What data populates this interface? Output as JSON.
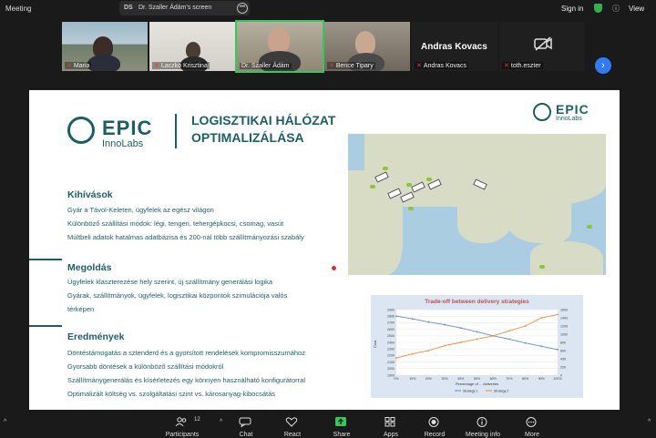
{
  "topbar": {
    "app_title": "Meeting",
    "share": {
      "initials": "DS",
      "label": "Dr. Szaller Ádám's screen",
      "more": "•••"
    },
    "sign_in": "Sign in",
    "view": "View"
  },
  "participants": [
    {
      "name": "Maria"
    },
    {
      "name": "Laczko Krisztina"
    },
    {
      "name": "Dr. Szaller Ádám"
    },
    {
      "name": "Bence Tipary"
    },
    {
      "name": "Andras Kovacs",
      "display": "Andras Kovacs"
    },
    {
      "name": "toth.eszter"
    }
  ],
  "slide": {
    "logo_main": "EPIC",
    "logo_sub": "InnoLabs",
    "title_line1": "LOGISZTIKAI HÁLÓZAT",
    "title_line2": "OPTIMALIZÁLÁSA",
    "sections": [
      {
        "heading": "Kihívások",
        "lines": [
          "Gyár a Távol-Keleten, ügyfelek az egész világon",
          "Különböző szállítási módok: légi, tengeri, tehergépkocsi, csomag, vasút",
          "Múltbeli adatok hatalmas adatbázisa és 200-nál több szállítmányozási szabály"
        ]
      },
      {
        "heading": "Megoldás",
        "lines": [
          "Ügyfelek klaszterezése hely szerint, új szállítmány generálási logika",
          "Gyárak, szállítmányok, ügyfelek, logisztikai központok szimulációja valós",
          "térképen"
        ]
      },
      {
        "heading": "Eredmények",
        "lines": [
          "Döntéstámogatás a sztenderd és a gyorsított rendelések kompromisszumához",
          "Gyorsabb döntések a különböző szállítási módokról",
          "Szállítmánygenerálás és kísérletezés egy könnyen használható konfigurátorral",
          "Optimalizált költség vs. szolgáltatási szint vs. károsanyag-kibocsátás"
        ]
      }
    ]
  },
  "chart_data": {
    "type": "line",
    "title": "Trade-off between delivery strategies",
    "x": [
      "0%",
      "10%",
      "20%",
      "30%",
      "40%",
      "50%",
      "60%",
      "70%",
      "80%",
      "90%",
      "100%"
    ],
    "xlabel": "Percentage of ... deliveries",
    "ylabel": "Cost",
    "y_left_ticks": [
      1900,
      2000,
      2100,
      2200,
      2300,
      2400,
      2500,
      2600,
      2700,
      2800,
      2900
    ],
    "y_right_ticks": [
      0,
      200,
      400,
      600,
      800,
      1000,
      1200,
      1400,
      1600
    ],
    "ylim_left": [
      1900,
      2900
    ],
    "ylim_right": [
      0,
      1600
    ],
    "series": [
      {
        "name": "Strategy 1",
        "axis": "left",
        "color": "#5b8fc7",
        "values": [
          2800,
          2760,
          2710,
          2670,
          2620,
          2560,
          2500,
          2450,
          2390,
          2340,
          2290
        ]
      },
      {
        "name": "Strategy 2",
        "axis": "right",
        "color": "#f08c3a",
        "values": [
          420,
          520,
          600,
          720,
          800,
          880,
          960,
          1080,
          1200,
          1400,
          1480
        ]
      }
    ],
    "legend": "bottom",
    "grid": true
  },
  "toolbar": [
    {
      "label": "Participants",
      "count": "12",
      "icon": "participants-icon"
    },
    {
      "label": "Chat",
      "icon": "chat-icon"
    },
    {
      "label": "React",
      "icon": "react-icon"
    },
    {
      "label": "Share",
      "icon": "share-icon"
    },
    {
      "label": "Apps",
      "icon": "apps-icon"
    },
    {
      "label": "Record",
      "icon": "record-icon"
    },
    {
      "label": "Meeting info",
      "icon": "info-icon"
    },
    {
      "label": "More",
      "icon": "more-icon"
    }
  ],
  "colors": {
    "accent": "#1a5f68",
    "share_green": "#35c759",
    "chart_bg": "#dbe6f2",
    "link_blue": "#2f7cf6"
  }
}
